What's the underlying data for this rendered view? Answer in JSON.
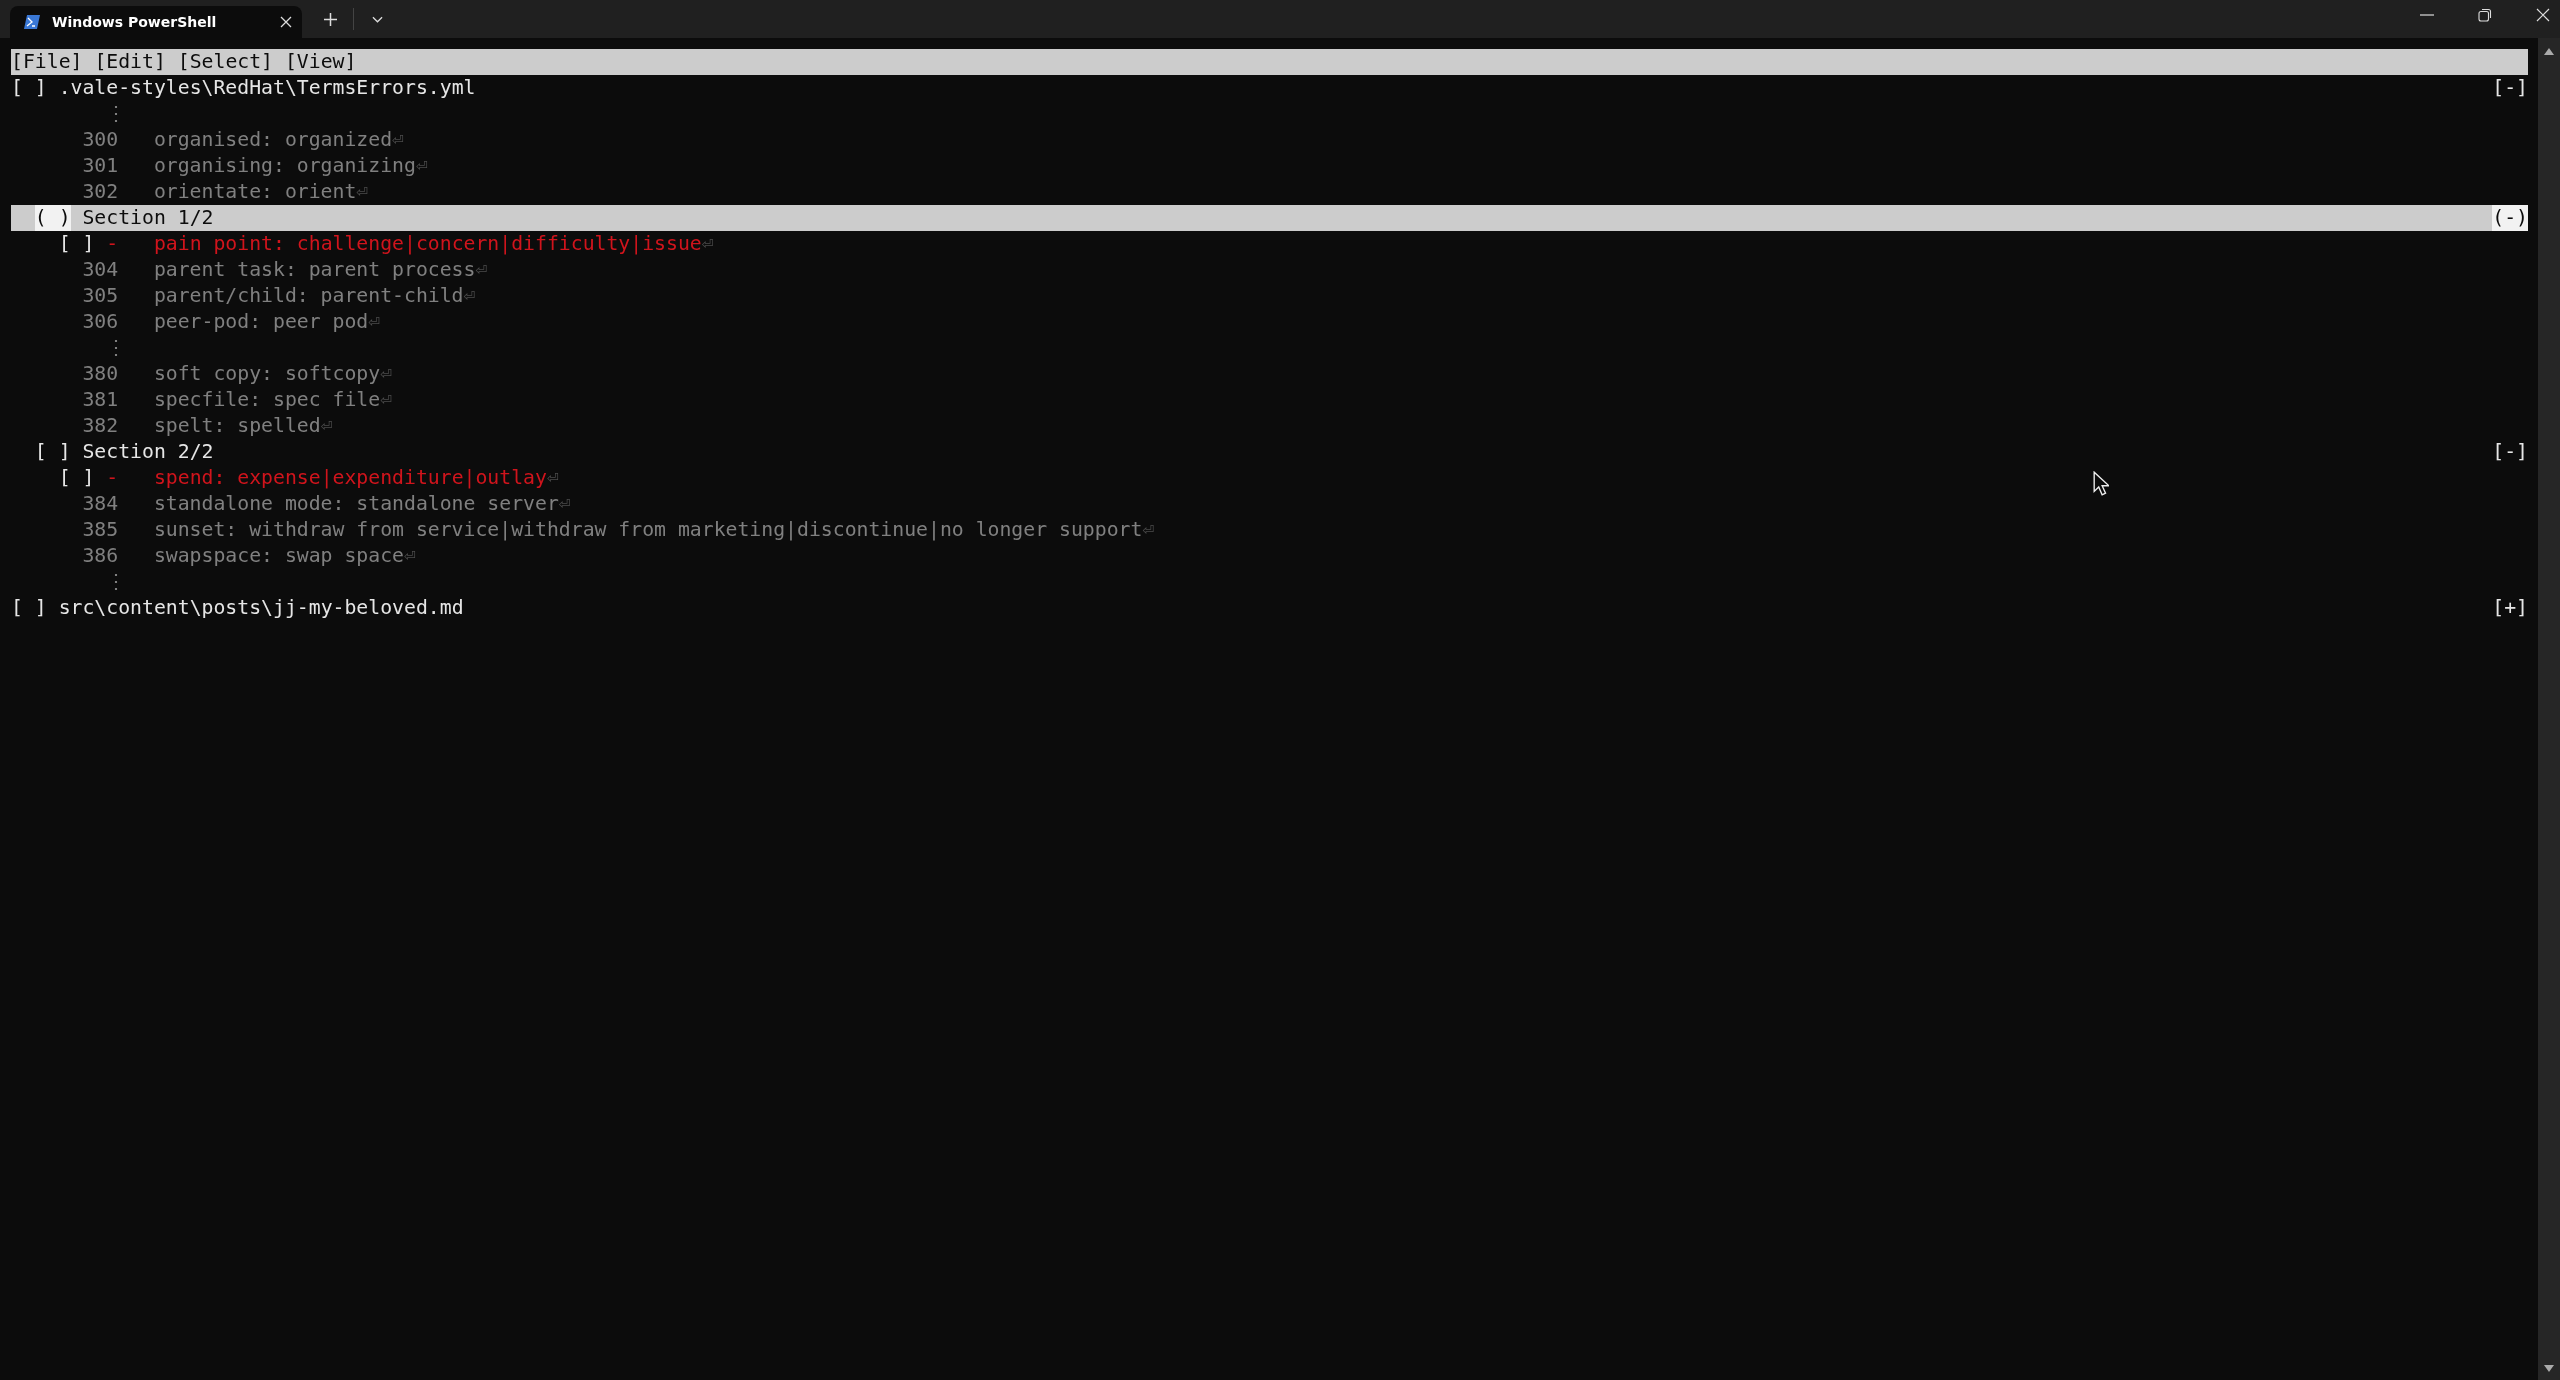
{
  "window": {
    "tab_title": "Windows PowerShell"
  },
  "menu": [
    {
      "label": "[File]"
    },
    {
      "label": "[Edit]"
    },
    {
      "label": "[Select]"
    },
    {
      "label": "[View]"
    }
  ],
  "files": [
    {
      "checkbox": "[ ]",
      "path": ".vale-styles\\RedHat\\TermsErrors.yml",
      "toggle": "[-]",
      "selected": false,
      "rows": [
        {
          "kind": "gap",
          "text": "⋮"
        },
        {
          "kind": "line",
          "number": "300",
          "text": "organised: organized",
          "eol": "⏎"
        },
        {
          "kind": "line",
          "number": "301",
          "text": "organising: organizing",
          "eol": "⏎"
        },
        {
          "kind": "line",
          "number": "302",
          "text": "orientate: orient",
          "eol": "⏎"
        },
        {
          "kind": "section",
          "checkbox": "( )",
          "title": "Section 1/2",
          "toggle": "(-)",
          "selected": true
        },
        {
          "kind": "change",
          "checkbox": "[ ]",
          "sign": "-",
          "text": "pain point: challenge|concern|difficulty|issue",
          "eol": "⏎",
          "selected": false
        },
        {
          "kind": "line",
          "number": "304",
          "text": "parent task: parent process",
          "eol": "⏎"
        },
        {
          "kind": "line",
          "number": "305",
          "text": "parent/child: parent-child",
          "eol": "⏎"
        },
        {
          "kind": "line",
          "number": "306",
          "text": "peer-pod: peer pod",
          "eol": "⏎"
        },
        {
          "kind": "gap",
          "text": "⋮"
        },
        {
          "kind": "line",
          "number": "380",
          "text": "soft copy: softcopy",
          "eol": "⏎"
        },
        {
          "kind": "line",
          "number": "381",
          "text": "specfile: spec file",
          "eol": "⏎"
        },
        {
          "kind": "line",
          "number": "382",
          "text": "spelt: spelled",
          "eol": "⏎"
        },
        {
          "kind": "section",
          "checkbox": "[ ]",
          "title": "Section 2/2",
          "toggle": "[-]",
          "selected": false
        },
        {
          "kind": "change",
          "checkbox": "[ ]",
          "sign": "-",
          "text": "spend: expense|expenditure|outlay",
          "eol": "⏎",
          "selected": false
        },
        {
          "kind": "line",
          "number": "384",
          "text": "standalone mode: standalone server",
          "eol": "⏎"
        },
        {
          "kind": "line",
          "number": "385",
          "text": "sunset: withdraw from service|withdraw from marketing|discontinue|no longer support",
          "eol": "⏎"
        },
        {
          "kind": "line",
          "number": "386",
          "text": "swapspace: swap space",
          "eol": "⏎"
        },
        {
          "kind": "gap",
          "text": "⋮"
        }
      ]
    },
    {
      "checkbox": "[ ]",
      "path": "src\\content\\posts\\jj-my-beloved.md",
      "toggle": "[+]",
      "selected": false
    }
  ]
}
